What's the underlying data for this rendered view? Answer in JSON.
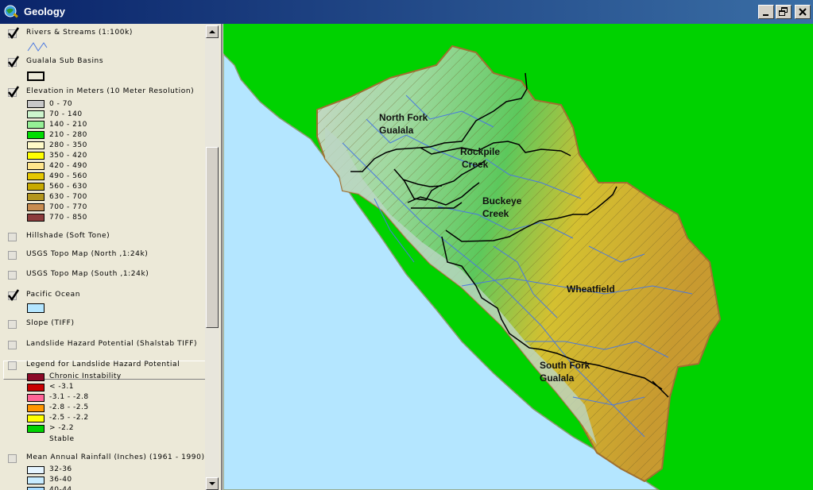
{
  "window": {
    "title": "Geology"
  },
  "toc": {
    "layers": [
      {
        "label": "Rivers & Streams (1:100k)",
        "checked": true
      },
      {
        "label": "Gualala Sub Basins",
        "checked": true
      },
      {
        "label": "Elevation in Meters (10 Meter Resolution)",
        "checked": true
      },
      {
        "label": "Hillshade (Soft Tone)",
        "checked": false
      },
      {
        "label": "USGS Topo Map (North ,1:24k)",
        "checked": false
      },
      {
        "label": "USGS Topo Map (South ,1:24k)",
        "checked": false
      },
      {
        "label": "Pacific Ocean",
        "checked": true
      },
      {
        "label": "Slope (TIFF)",
        "checked": false
      },
      {
        "label": "Landslide Hazard Potential (Shalstab TIFF)",
        "checked": false
      },
      {
        "label": "Legend for Landslide Hazard Potential",
        "checked": false
      },
      {
        "label": "Mean Annual Rainfall (Inches) (1961 - 1990)",
        "checked": false
      }
    ],
    "elevation_legend": [
      {
        "label": "0 - 70",
        "color": "#c8c8c8"
      },
      {
        "label": "70 - 140",
        "color": "#cdf5cd"
      },
      {
        "label": "140 - 210",
        "color": "#96f096"
      },
      {
        "label": "210 - 280",
        "color": "#00dc00"
      },
      {
        "label": "280 - 350",
        "color": "#fffac8"
      },
      {
        "label": "350 - 420",
        "color": "#ffff00"
      },
      {
        "label": "420 - 490",
        "color": "#ffe68c"
      },
      {
        "label": "490 - 560",
        "color": "#e6c800"
      },
      {
        "label": "560 - 630",
        "color": "#c8aa00"
      },
      {
        "label": "630 - 700",
        "color": "#b4961e"
      },
      {
        "label": "700 - 770",
        "color": "#c88c50"
      },
      {
        "label": "770 - 850",
        "color": "#8c3c3c"
      }
    ],
    "landslide_legend": {
      "header": "Chronic Instability",
      "items": [
        {
          "label": "< -3.1",
          "color": "#c80000"
        },
        {
          "label": "-3.1 - -2.8",
          "color": "#ff6496"
        },
        {
          "label": "-2.8 - -2.5",
          "color": "#ff9600"
        },
        {
          "label": "-2.5 - -2.2",
          "color": "#ffff00"
        },
        {
          "label": "> -2.2",
          "color": "#00d200"
        }
      ],
      "footer": "Stable"
    },
    "rainfall_legend": [
      {
        "label": "32-36",
        "color": "#e6f5ff"
      },
      {
        "label": "36-40",
        "color": "#c8ecff"
      },
      {
        "label": "40-44",
        "color": "#aadcff"
      }
    ],
    "ocean_color": "#b4e6ff",
    "stream_color": "#4a78e0"
  },
  "map": {
    "labels": {
      "north_fork_1": "North Fork",
      "north_fork_2": "Gualala",
      "rockpile_1": "Rockpile",
      "rockpile_2": "Creek",
      "buckeye_1": "Buckeye",
      "buckeye_2": "Creek",
      "wheatfield": "Wheatfield",
      "south_fork_1": "South Fork",
      "south_fork_2": "Gualala"
    },
    "land_color": "#00d200",
    "ocean_color": "#b4e6ff"
  }
}
